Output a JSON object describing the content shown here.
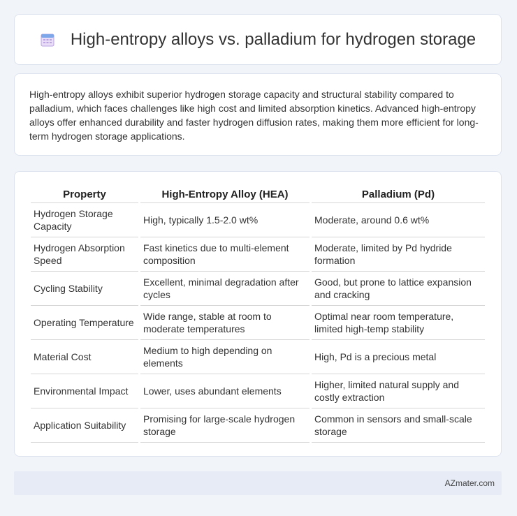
{
  "header": {
    "title": "High-entropy alloys vs. palladium for hydrogen storage",
    "icon": "calendar-icon"
  },
  "intro": {
    "text": "High-entropy alloys exhibit superior hydrogen storage capacity and structural stability compared to palladium, which faces challenges like high cost and limited absorption kinetics. Advanced high-entropy alloys offer enhanced durability and faster hydrogen diffusion rates, making them more efficient for long-term hydrogen storage applications."
  },
  "table": {
    "headers": [
      "Property",
      "High-Entropy Alloy (HEA)",
      "Palladium (Pd)"
    ],
    "rows": [
      [
        "Hydrogen Storage Capacity",
        "High, typically 1.5-2.0 wt%",
        "Moderate, around 0.6 wt%"
      ],
      [
        "Hydrogen Absorption Speed",
        "Fast kinetics due to multi-element composition",
        "Moderate, limited by Pd hydride formation"
      ],
      [
        "Cycling Stability",
        "Excellent, minimal degradation after cycles",
        "Good, but prone to lattice expansion and cracking"
      ],
      [
        "Operating Temperature",
        "Wide range, stable at room to moderate temperatures",
        "Optimal near room temperature, limited high-temp stability"
      ],
      [
        "Material Cost",
        "Medium to high depending on elements",
        "High, Pd is a precious metal"
      ],
      [
        "Environmental Impact",
        "Lower, uses abundant elements",
        "Higher, limited natural supply and costly extraction"
      ],
      [
        "Application Suitability",
        "Promising for large-scale hydrogen storage",
        "Common in sensors and small-scale storage"
      ]
    ]
  },
  "footer": {
    "brand": "AZmater.com"
  }
}
